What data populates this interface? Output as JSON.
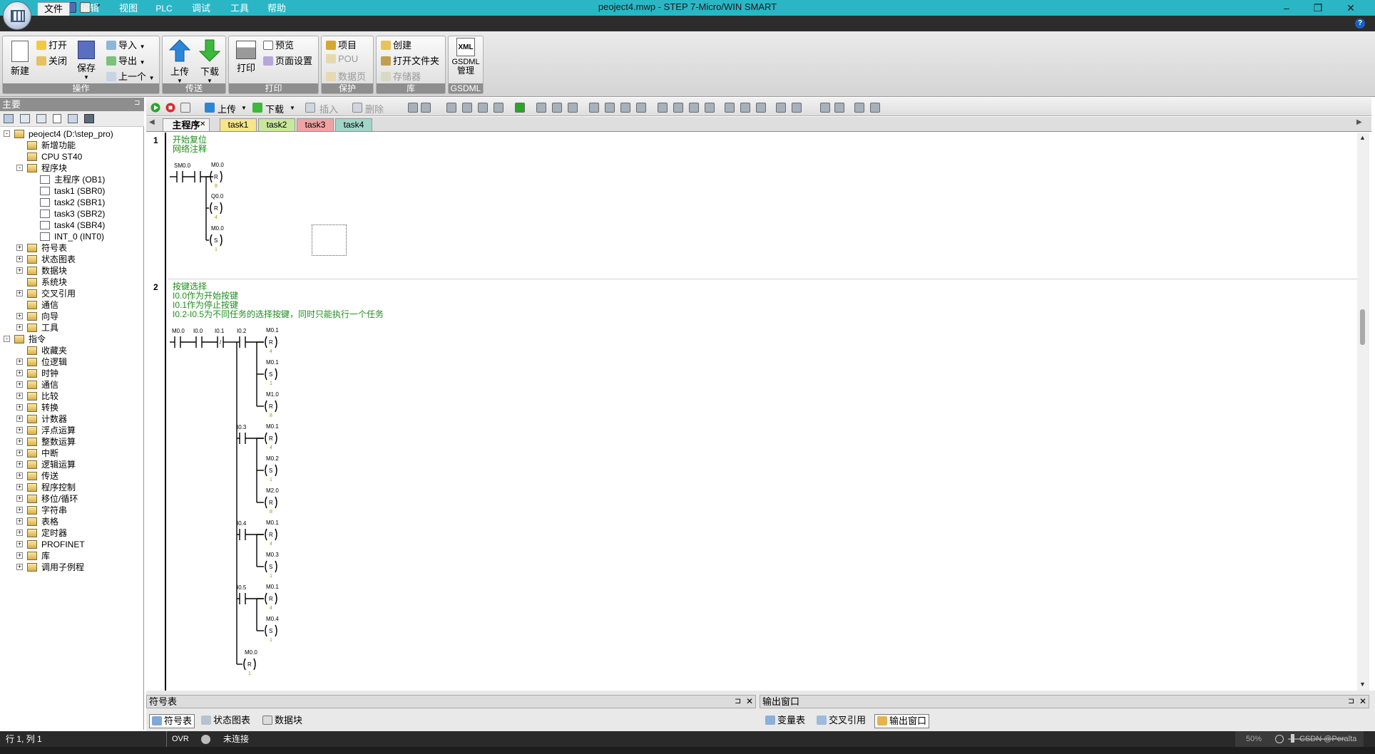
{
  "window": {
    "title": "peoject4.mwp - STEP 7-Micro/WIN SMART",
    "minimize": "–",
    "restore": "❐",
    "close": "✕"
  },
  "menu": [
    "文件",
    "编辑",
    "视图",
    "PLC",
    "调试",
    "工具",
    "帮助"
  ],
  "ribbon": {
    "groups": [
      {
        "name": "操作",
        "new": "新建",
        "open": "打开",
        "close": "关闭",
        "save": "保存",
        "import": "导入",
        "export": "导出",
        "previous": "上一个"
      },
      {
        "name": "传送",
        "upload": "上传",
        "download": "下载"
      },
      {
        "name": "打印",
        "print": "打印",
        "preview": "预览",
        "page_setup": "页面设置"
      },
      {
        "name": "保护",
        "project": "项目",
        "pou": "POU",
        "data_page": "数据页"
      },
      {
        "name": "库",
        "create": "创建",
        "open_folder": "打开文件夹",
        "memory": "存储器"
      },
      {
        "name": "GSDML",
        "xml": "XML",
        "manage": "管理"
      }
    ]
  },
  "left_panel": {
    "title": "主要",
    "tree": [
      {
        "label": "peoject4 (D:\\step_pro)",
        "level": 0,
        "exp": "-"
      },
      {
        "label": "新增功能",
        "level": 1
      },
      {
        "label": "CPU ST40",
        "level": 1
      },
      {
        "label": "程序块",
        "level": 1,
        "exp": "-"
      },
      {
        "label": "主程序 (OB1)",
        "level": 2
      },
      {
        "label": "task1 (SBR0)",
        "level": 2
      },
      {
        "label": "task2 (SBR1)",
        "level": 2
      },
      {
        "label": "task3 (SBR2)",
        "level": 2
      },
      {
        "label": "task4 (SBR4)",
        "level": 2
      },
      {
        "label": "INT_0 (INT0)",
        "level": 2
      },
      {
        "label": "符号表",
        "level": 1,
        "exp": "+"
      },
      {
        "label": "状态图表",
        "level": 1,
        "exp": "+"
      },
      {
        "label": "数据块",
        "level": 1,
        "exp": "+"
      },
      {
        "label": "系统块",
        "level": 1
      },
      {
        "label": "交叉引用",
        "level": 1,
        "exp": "+"
      },
      {
        "label": "通信",
        "level": 1
      },
      {
        "label": "向导",
        "level": 1,
        "exp": "+"
      },
      {
        "label": "工具",
        "level": 1,
        "exp": "+"
      },
      {
        "label": "指令",
        "level": 0,
        "exp": "-"
      },
      {
        "label": "收藏夹",
        "level": 1
      },
      {
        "label": "位逻辑",
        "level": 1,
        "exp": "+"
      },
      {
        "label": "时钟",
        "level": 1,
        "exp": "+"
      },
      {
        "label": "通信",
        "level": 1,
        "exp": "+"
      },
      {
        "label": "比较",
        "level": 1,
        "exp": "+"
      },
      {
        "label": "转换",
        "level": 1,
        "exp": "+"
      },
      {
        "label": "计数器",
        "level": 1,
        "exp": "+"
      },
      {
        "label": "浮点运算",
        "level": 1,
        "exp": "+"
      },
      {
        "label": "整数运算",
        "level": 1,
        "exp": "+"
      },
      {
        "label": "中断",
        "level": 1,
        "exp": "+"
      },
      {
        "label": "逻辑运算",
        "level": 1,
        "exp": "+"
      },
      {
        "label": "传送",
        "level": 1,
        "exp": "+"
      },
      {
        "label": "程序控制",
        "level": 1,
        "exp": "+"
      },
      {
        "label": "移位/循环",
        "level": 1,
        "exp": "+"
      },
      {
        "label": "字符串",
        "level": 1,
        "exp": "+"
      },
      {
        "label": "表格",
        "level": 1,
        "exp": "+"
      },
      {
        "label": "定时器",
        "level": 1,
        "exp": "+"
      },
      {
        "label": "PROFINET",
        "level": 1,
        "exp": "+"
      },
      {
        "label": "库",
        "level": 1,
        "exp": "+"
      },
      {
        "label": "调用子例程",
        "level": 1,
        "exp": "+"
      }
    ]
  },
  "toolbar": {
    "upload": "上传",
    "download": "下载",
    "insert": "插入",
    "delete": "删除"
  },
  "tabs": [
    {
      "label": "主程序",
      "color": "#f4f4f4"
    },
    {
      "label": "task1",
      "color": "#f7e58a"
    },
    {
      "label": "task2",
      "color": "#c9e79a"
    },
    {
      "label": "task3",
      "color": "#f0a3a3"
    },
    {
      "label": "task4",
      "color": "#9fd6c8"
    }
  ],
  "networks": [
    {
      "number": "1",
      "comment": [
        "开始复位",
        "网络注释"
      ],
      "contacts": [
        "SM0.0"
      ],
      "coils": [
        {
          "addr": "M0.0",
          "op": "R",
          "n": "8"
        },
        {
          "addr": "Q0.0",
          "op": "R",
          "n": "4"
        },
        {
          "addr": "M0.0",
          "op": "S",
          "n": "1"
        }
      ]
    },
    {
      "number": "2",
      "comment": [
        "按键选择",
        "I0.0作为开始按键",
        "I0.1作为停止按键",
        "I0.2-I0.5为不同任务的选择按键，同时只能执行一个任务"
      ],
      "contacts": [
        "M0.0",
        "I0.0",
        "I0.1"
      ],
      "branches": [
        {
          "contact": "I0.2",
          "coils": [
            {
              "addr": "M0.1",
              "op": "R",
              "n": "4"
            },
            {
              "addr": "M0.1",
              "op": "S",
              "n": "1"
            },
            {
              "addr": "M1.0",
              "op": "R",
              "n": "8"
            }
          ]
        },
        {
          "contact": "I0.3",
          "coils": [
            {
              "addr": "M0.1",
              "op": "R",
              "n": "4"
            },
            {
              "addr": "M0.2",
              "op": "S",
              "n": "1"
            },
            {
              "addr": "M2.0",
              "op": "R",
              "n": "8"
            }
          ]
        },
        {
          "contact": "I0.4",
          "coils": [
            {
              "addr": "M0.1",
              "op": "R",
              "n": "4"
            },
            {
              "addr": "M0.3",
              "op": "S",
              "n": "1"
            }
          ]
        },
        {
          "contact": "I0.5",
          "coils": [
            {
              "addr": "M0.1",
              "op": "R",
              "n": "4"
            },
            {
              "addr": "M0.4",
              "op": "S",
              "n": "1"
            }
          ]
        }
      ],
      "final_coil": {
        "addr": "M0.0",
        "op": "R",
        "n": "1"
      }
    }
  ],
  "bottom": {
    "symbol_panel": "符号表",
    "output_panel": "输出窗口",
    "left_tabs": [
      "符号表",
      "状态图表",
      "数据块"
    ],
    "right_tabs": [
      "变量表",
      "交叉引用",
      "输出窗口"
    ]
  },
  "status": {
    "position": "行 1, 列 1",
    "ovr": "OVR",
    "connection": "未连接",
    "zoom": "50%",
    "watermark": "CSDN @Peralta"
  }
}
